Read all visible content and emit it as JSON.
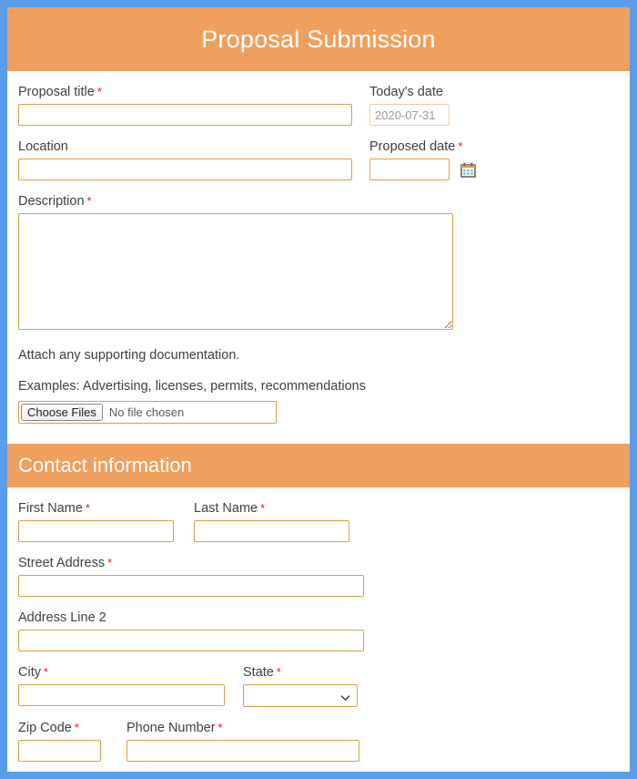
{
  "theme": {
    "border_color": "#5b9ce8",
    "header_color": "#f0a05e",
    "field_border_color": "#e8993f",
    "required_marker_color": "#ff1010",
    "label_color": "#3f3f3f"
  },
  "header": {
    "title": "Proposal Submission"
  },
  "proposal_section": {
    "fields": {
      "proposal_title": {
        "label": "Proposal title",
        "required_marker": "*",
        "value": "",
        "placeholder": ""
      },
      "todays_date": {
        "label": "Today's date",
        "required_marker": "",
        "value": "2020-07-31",
        "disabled": true
      },
      "location": {
        "label": "Location",
        "required_marker": "",
        "value": "",
        "placeholder": ""
      },
      "proposed_date": {
        "label": "Proposed date",
        "required_marker": "*",
        "value": "",
        "placeholder": "",
        "icon": "calendar-icon"
      },
      "description": {
        "label": "Description",
        "required_marker": "*",
        "value": "",
        "placeholder": ""
      }
    },
    "attachment": {
      "instruction": "Attach any supporting documentation.",
      "examples": "Examples: Advertising, licenses, permits, recommendations",
      "button_label": "Choose Files",
      "status_text": "No file chosen"
    }
  },
  "contact_section": {
    "title": "Contact information",
    "fields": {
      "first_name": {
        "label": "First Name",
        "required_marker": "*",
        "value": "",
        "placeholder": ""
      },
      "last_name": {
        "label": "Last Name",
        "required_marker": "*",
        "value": "",
        "placeholder": ""
      },
      "street_address": {
        "label": "Street Address",
        "required_marker": "*",
        "value": "",
        "placeholder": ""
      },
      "address_line_2": {
        "label": "Address Line 2",
        "required_marker": "",
        "value": "",
        "placeholder": ""
      },
      "city": {
        "label": "City",
        "required_marker": "*",
        "value": "",
        "placeholder": ""
      },
      "state": {
        "label": "State",
        "required_marker": "*",
        "selected_option": "",
        "options": [
          ""
        ]
      },
      "zip_code": {
        "label": "Zip Code",
        "required_marker": "*",
        "value": "",
        "placeholder": ""
      },
      "phone_number": {
        "label": "Phone Number",
        "required_marker": "*",
        "value": "",
        "placeholder": ""
      }
    }
  }
}
